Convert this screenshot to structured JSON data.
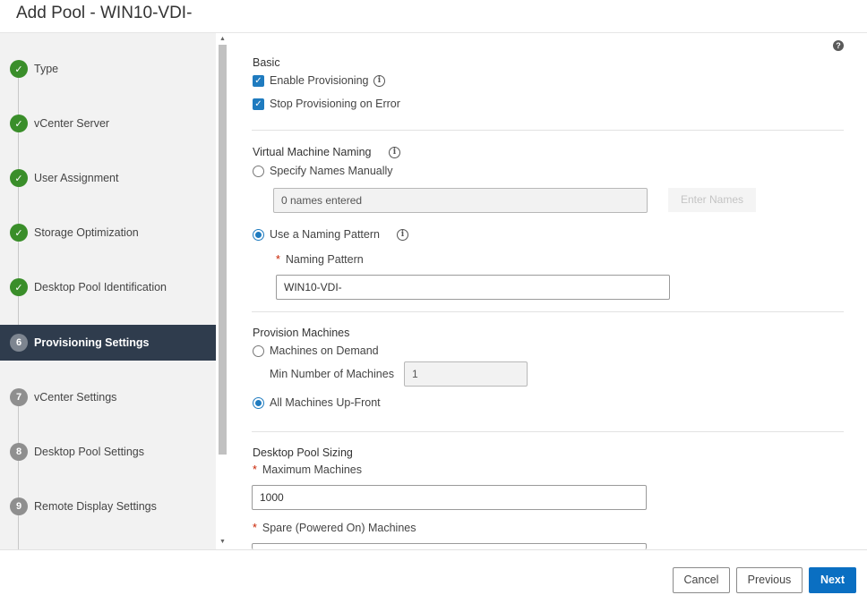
{
  "window": {
    "title": "Add Pool - WIN10-VDI-"
  },
  "sidebar": {
    "steps": [
      {
        "label": "Type",
        "status": "done"
      },
      {
        "label": "vCenter Server",
        "status": "done"
      },
      {
        "label": "User Assignment",
        "status": "done"
      },
      {
        "label": "Storage Optimization",
        "status": "done"
      },
      {
        "label": "Desktop Pool Identification",
        "status": "done"
      },
      {
        "label": "Provisioning Settings",
        "status": "current",
        "number": "6"
      },
      {
        "label": "vCenter Settings",
        "status": "pending",
        "number": "7"
      },
      {
        "label": "Desktop Pool Settings",
        "status": "pending",
        "number": "8"
      },
      {
        "label": "Remote Display Settings",
        "status": "pending",
        "number": "9"
      }
    ]
  },
  "help": {
    "icon": "question-icon",
    "glyph": "?"
  },
  "basic": {
    "title": "Basic",
    "enable_provisioning": {
      "label": "Enable Provisioning",
      "checked": true
    },
    "stop_on_error": {
      "label": "Stop Provisioning on Error",
      "checked": true
    }
  },
  "vm_naming": {
    "title": "Virtual Machine Naming",
    "specify_manually": {
      "label": "Specify Names Manually",
      "selected": false
    },
    "names_field_value": "0 names entered",
    "enter_names_label": "Enter Names",
    "naming_pattern_option": {
      "label": "Use a Naming Pattern",
      "selected": true
    },
    "naming_pattern_label": "Naming Pattern",
    "naming_pattern_value": "WIN10-VDI-"
  },
  "provision_machines": {
    "title": "Provision Machines",
    "on_demand": {
      "label": "Machines on Demand",
      "selected": false
    },
    "min_number_label": "Min Number of Machines",
    "min_number_value": "1",
    "up_front": {
      "label": "All Machines Up-Front",
      "selected": true
    }
  },
  "pool_sizing": {
    "title": "Desktop Pool Sizing",
    "max_machines_label": "Maximum Machines",
    "max_machines_value": "1000",
    "spare_label": "Spare (Powered On) Machines"
  },
  "footer": {
    "cancel_label": "Cancel",
    "previous_label": "Previous",
    "next_label": "Next"
  },
  "colors": {
    "accent": "#0a6fc2",
    "done": "#3a8e2a",
    "active_bg": "#2f3c4d",
    "required": "#c92100"
  }
}
